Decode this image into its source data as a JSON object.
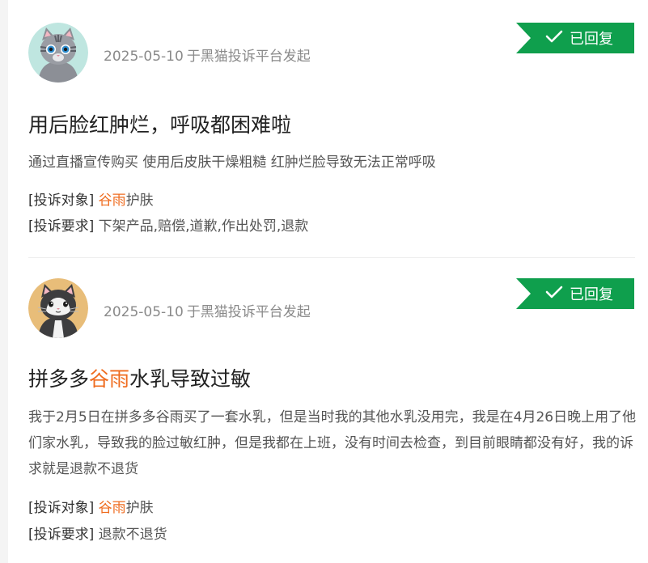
{
  "complaints": [
    {
      "date": "2025-05-10",
      "source": "于黑猫投诉平台发起",
      "status": "已回复",
      "title_pre": "用后脸红肿烂，呼吸都困难啦",
      "title_brand": "",
      "title_post": "",
      "description": "通过直播宣传购买 使用后皮肤干燥粗糙 红肿烂脸导致无法正常呼吸",
      "target_label": "[投诉对象]",
      "target_brand": "谷雨",
      "target_rest": "护肤",
      "demand_label": "[投诉要求]",
      "demand_value": "下架产品,赔偿,道歉,作出处罚,退款",
      "avatar_icon": "gray-tabby-cat-icon"
    },
    {
      "date": "2025-05-10",
      "source": "于黑猫投诉平台发起",
      "status": "已回复",
      "title_pre": "拼多多",
      "title_brand": "谷雨",
      "title_post": "水乳导致过敏",
      "description": "我于2月5日在拼多多谷雨买了一套水乳，但是当时我的其他水乳没用完，我是在4月26日晚上用了他们家水乳，导致我的脸过敏红肿，但是我都在上班，没有时间去检查，到目前眼睛都没有好，我的诉求就是退款不退货",
      "target_label": "[投诉对象]",
      "target_brand": "谷雨",
      "target_rest": "护肤",
      "demand_label": "[投诉要求]",
      "demand_value": "退款不退货",
      "avatar_icon": "black-white-cat-icon"
    }
  ],
  "colors": {
    "badge": "#0f9f4d",
    "brand": "#ef6c1f",
    "meta": "#8a8a8a"
  }
}
